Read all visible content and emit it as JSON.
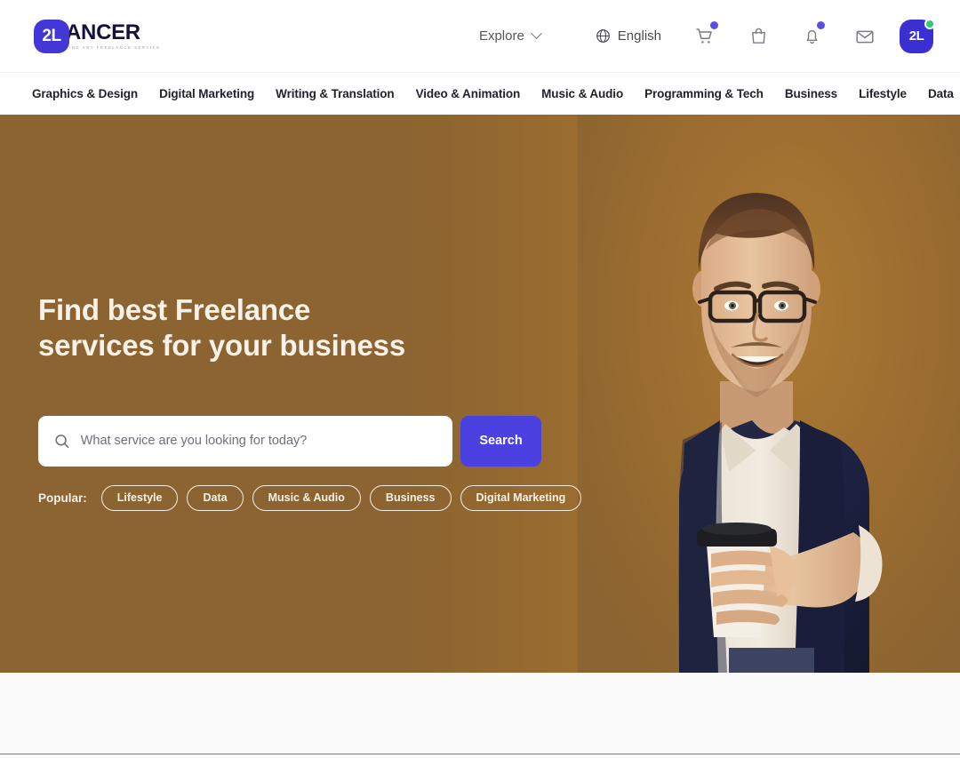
{
  "brand": {
    "mark": "2L",
    "name": "ANCER",
    "tagline": "FIND ANY FREELANCE SERVICE"
  },
  "header": {
    "explore_label": "Explore",
    "explore_icon": "chevron-down-icon",
    "language_label": "English",
    "language_icon": "globe-icon",
    "icons": [
      {
        "name": "cart-icon",
        "badge": true
      },
      {
        "name": "shopping-bag-icon",
        "badge": false
      },
      {
        "name": "bell-icon",
        "badge": true
      },
      {
        "name": "envelope-icon",
        "badge": false
      }
    ],
    "avatar": {
      "initials": "2L",
      "status": "online"
    }
  },
  "categories": [
    "Graphics & Design",
    "Digital Marketing",
    "Writing & Translation",
    "Video & Animation",
    "Music & Audio",
    "Programming & Tech",
    "Business",
    "Lifestyle",
    "Data"
  ],
  "hero": {
    "title_line1": "Find best Freelance",
    "title_line2": "services for your business",
    "search": {
      "icon": "search-icon",
      "placeholder": "What service are you looking for today?",
      "value": "",
      "button_label": "Search"
    },
    "popular_label": "Popular:",
    "popular_tags": [
      "Lifestyle",
      "Data",
      "Music & Audio",
      "Business",
      "Digital Marketing"
    ],
    "image_alt": "smiling-man-with-glasses-holding-coffee-cup"
  },
  "colors": {
    "brand_indigo": "#4a41e0",
    "hero_brown": "#8b6431",
    "hero_brown_light": "#ad7a34",
    "badge_purple": "#5b4ee8",
    "status_green": "#2fcc71",
    "heading_cream": "#f6f1e9"
  }
}
